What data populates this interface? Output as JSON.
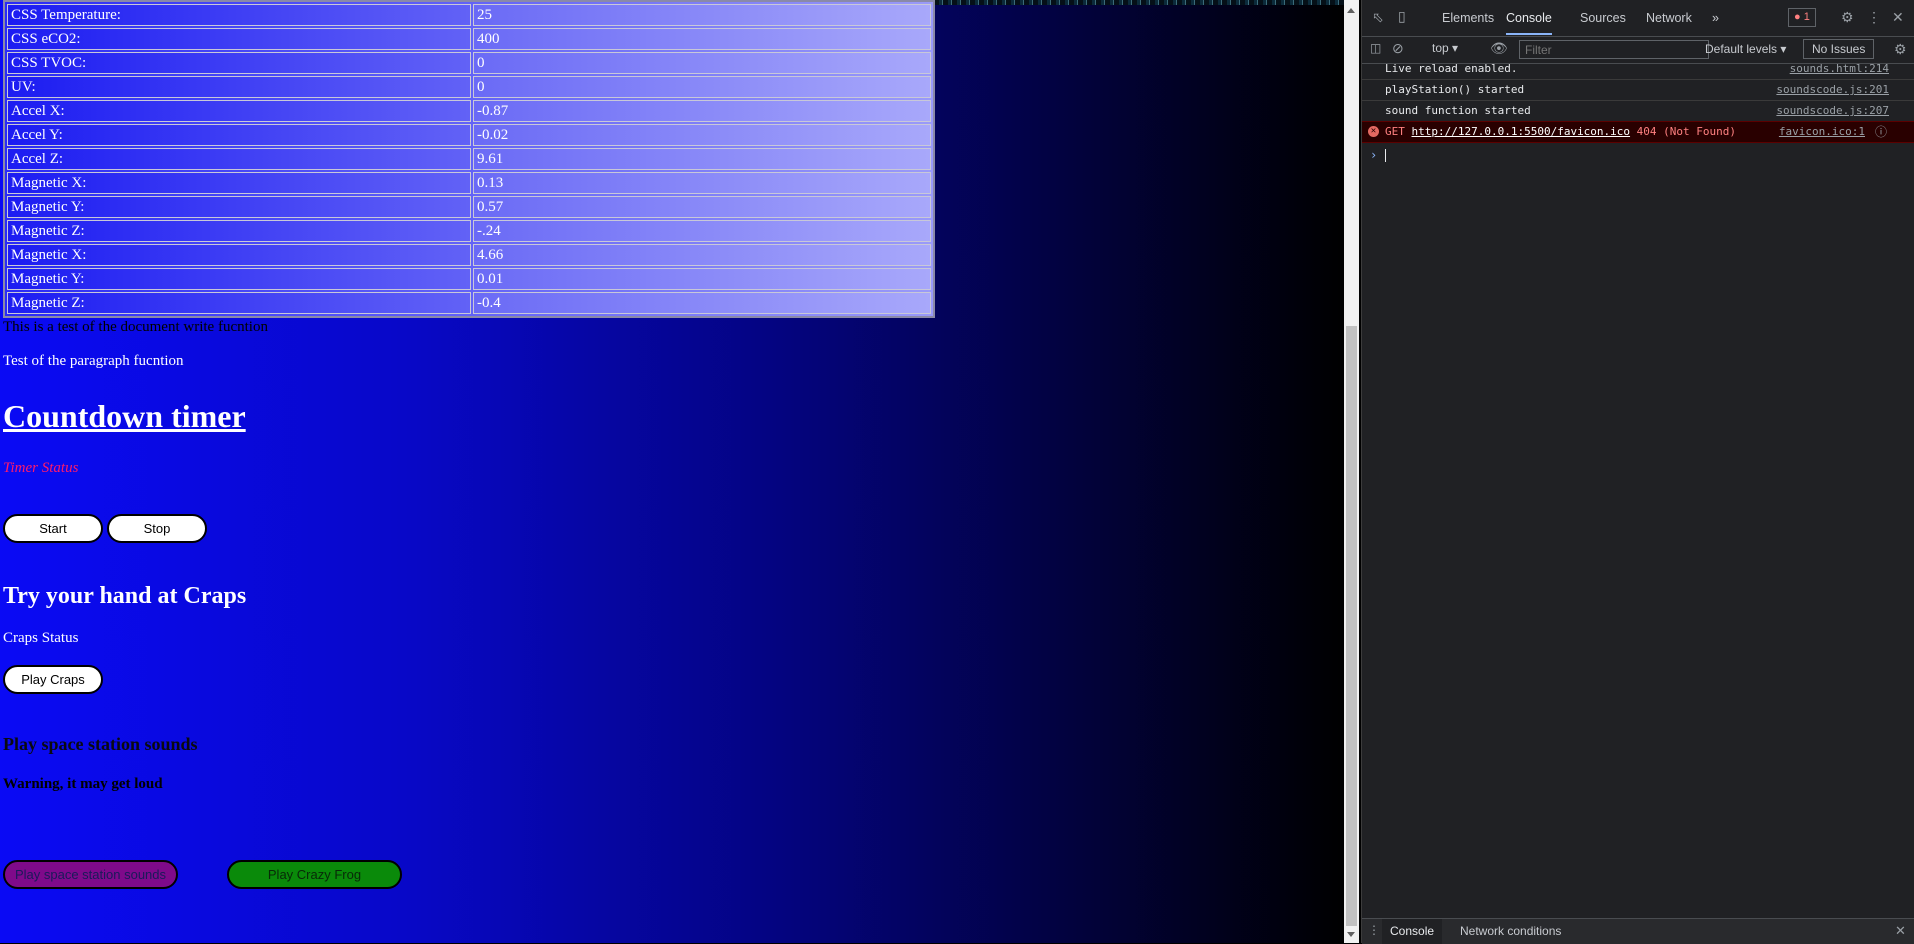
{
  "sensor_table": [
    {
      "label": "CSS Temperature:",
      "value": "25"
    },
    {
      "label": "CSS eCO2:",
      "value": "400"
    },
    {
      "label": "CSS TVOC:",
      "value": "0"
    },
    {
      "label": "UV:",
      "value": "0"
    },
    {
      "label": "Accel X:",
      "value": "-0.87"
    },
    {
      "label": "Accel Y:",
      "value": "-0.02"
    },
    {
      "label": "Accel Z:",
      "value": "9.61"
    },
    {
      "label": "Magnetic X:",
      "value": "0.13"
    },
    {
      "label": "Magnetic Y:",
      "value": "0.57"
    },
    {
      "label": "Magnetic Z:",
      "value": "-.24"
    },
    {
      "label": "Magnetic X:",
      "value": "4.66"
    },
    {
      "label": "Magnetic Y:",
      "value": "0.01"
    },
    {
      "label": "Magnetic Z:",
      "value": "-0.4"
    }
  ],
  "page": {
    "doc_write_text": "This is a test of the document write fucntion",
    "paragraph_text": "Test of the paragraph fucntion",
    "countdown_title": "Countdown timer",
    "timer_status": "Timer Status",
    "start_label": "Start",
    "stop_label": "Stop",
    "craps_title": "Try your hand at Craps",
    "craps_status": "Craps Status",
    "play_craps_label": "Play Craps",
    "space_title": "Play space station sounds",
    "warning_text": "Warning, it may get loud",
    "space_button_label": "Play space station sounds",
    "frog_button_label": "Play Crazy Frog"
  },
  "devtools": {
    "tabs": [
      "Elements",
      "Console",
      "Sources",
      "Network"
    ],
    "active_tab": "Console",
    "more_tabs": "»",
    "error_count": "1",
    "context": "top",
    "filter_placeholder": "Filter",
    "levels": "Default levels",
    "issues": "No Issues",
    "logs": [
      {
        "message": "Live reload enabled.",
        "source": "sounds.html:214"
      },
      {
        "message": "playStation() started",
        "source": "soundscode.js:201"
      },
      {
        "message": "sound function started",
        "source": "soundscode.js:207"
      }
    ],
    "error": {
      "method": "GET",
      "url": "http://127.0.0.1:5500/favicon.ico",
      "status": "404 (Not Found)",
      "source": "favicon.ico:1"
    },
    "drawer_tabs": [
      "Console",
      "Network conditions"
    ]
  },
  "colors": {
    "timer_status": "#ff1a6a",
    "space_button": "#7f0a8a",
    "frog_button": "#0a8a0a",
    "console_error": "#ff8080"
  }
}
